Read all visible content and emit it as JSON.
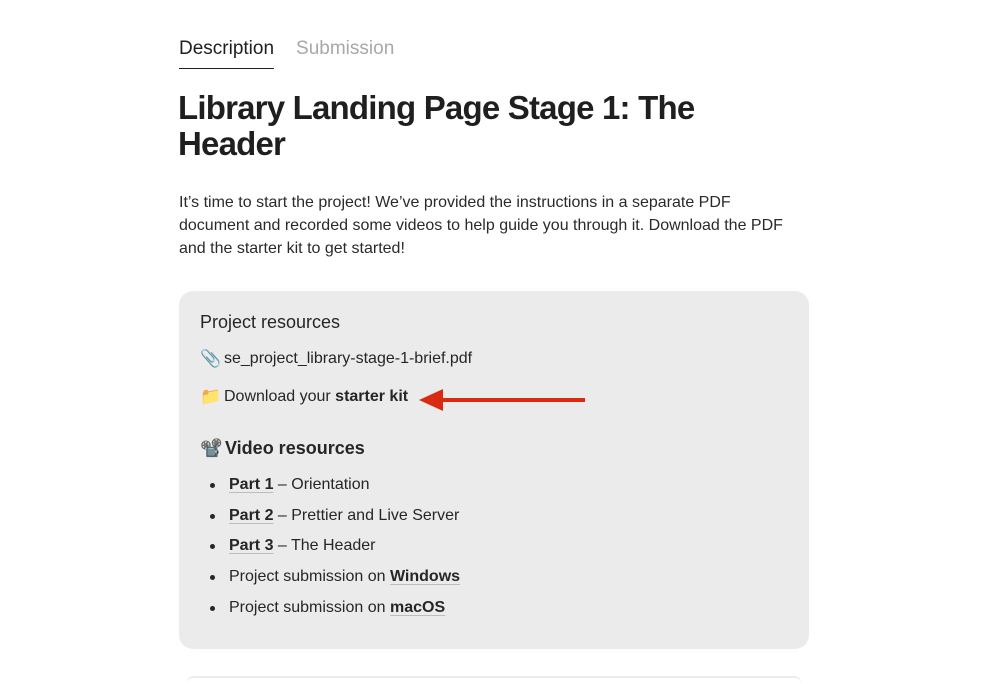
{
  "tabs": [
    {
      "label": "Description",
      "active": true
    },
    {
      "label": "Submission",
      "active": false
    }
  ],
  "page_title": "Library Landing Page Stage 1: The Header",
  "intro": "It’s time to start the project! We’ve provided the instructions in a separate PDF document and recorded some videos to help guide you through it. Download the PDF and the starter kit to get started!",
  "resources": {
    "heading": "Project resources",
    "pdf": {
      "icon": "paperclip-icon",
      "glyph": "📎",
      "label": "se_project_library-stage-1-brief.pdf"
    },
    "starter_kit": {
      "icon": "folder-icon",
      "glyph": "📁",
      "prefix": "Download your ",
      "link": "starter kit"
    },
    "video_heading": {
      "icon": "film-projector-icon",
      "glyph": "📽️",
      "label": "Video resources"
    },
    "videos": [
      {
        "link": "Part 1",
        "rest": " – Orientation"
      },
      {
        "link": "Part 2",
        "rest": " – Prettier and Live Server"
      },
      {
        "link": "Part 3",
        "rest": " – The Header"
      },
      {
        "prefix": "Project submission on ",
        "link": "Windows"
      },
      {
        "prefix": "Project submission on ",
        "link": "macOS"
      }
    ]
  },
  "colors": {
    "arrow": "#d92b12",
    "panel_bg": "#ebebeb",
    "text": "#262626",
    "inactive_tab": "#a8a8a8"
  }
}
